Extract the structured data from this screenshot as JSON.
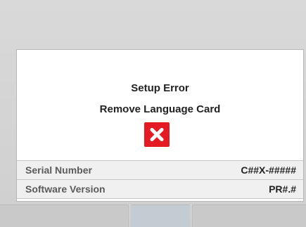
{
  "dialog": {
    "title": "Setup Error",
    "message": "Remove Language Card",
    "icon": "error-x-icon",
    "icon_color": "#e41b23"
  },
  "info": {
    "serial_label": "Serial Number",
    "serial_value": "C##X-#####",
    "software_label": "Software Version",
    "software_value": "PR#.#"
  },
  "softkeys": [
    "",
    "",
    ""
  ]
}
